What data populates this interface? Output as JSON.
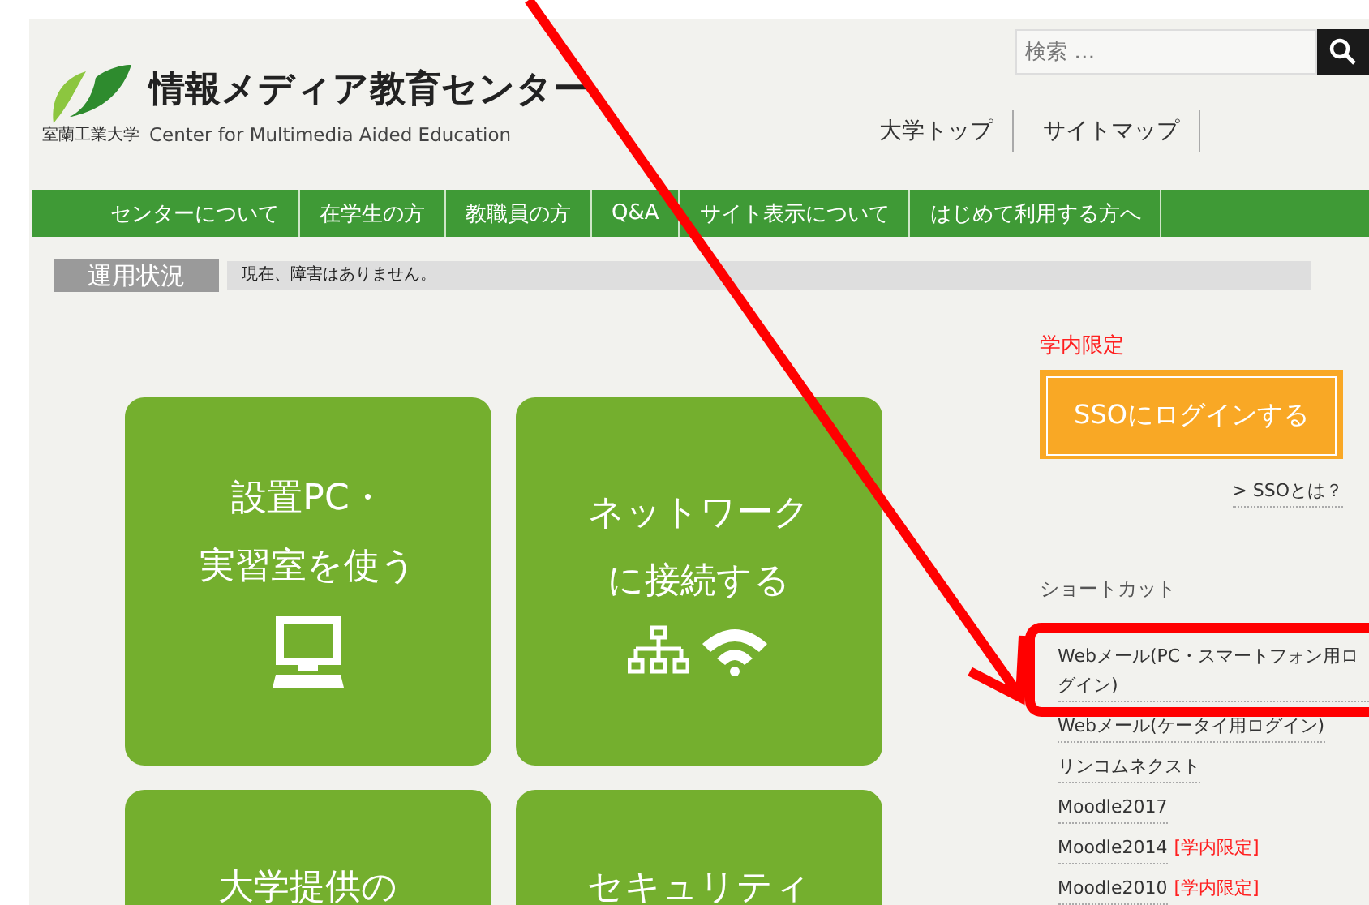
{
  "header": {
    "logo_caption": "室蘭工業大学",
    "title": "情報メディア教育センター",
    "subtitle": "Center for Multimedia Aided Education",
    "search": {
      "placeholder": "検索 …"
    },
    "links": [
      "大学トップ",
      "サイトマップ"
    ]
  },
  "nav": [
    "センターについて",
    "在学生の方",
    "教職員の方",
    "Q&A",
    "サイト表示について",
    "はじめて利用する方へ"
  ],
  "status": {
    "label": "運用状況",
    "message": "現在、障害はありません。"
  },
  "cards": [
    {
      "lines": [
        "設置PC・",
        "実習室を使う"
      ]
    },
    {
      "lines": [
        "ネットワーク",
        "に接続する"
      ]
    },
    {
      "lines": [
        "大学提供の"
      ]
    },
    {
      "lines": [
        "セキュリティ"
      ]
    }
  ],
  "sso": {
    "notice": "学内限定",
    "button": "SSOにログインする",
    "about": "> SSOとは？"
  },
  "shortcuts": {
    "title": "ショートカット",
    "items": [
      {
        "label": "Webメール(PC・スマートフォン用ログイン)"
      },
      {
        "label": "Webメール(ケータイ用ログイン)"
      },
      {
        "label": "リンコムネクスト"
      },
      {
        "label": "Moodle2017"
      },
      {
        "label": "Moodle2014",
        "tag": "[学内限定]"
      },
      {
        "label": "Moodle2010",
        "tag": "[学内限定]"
      }
    ]
  }
}
